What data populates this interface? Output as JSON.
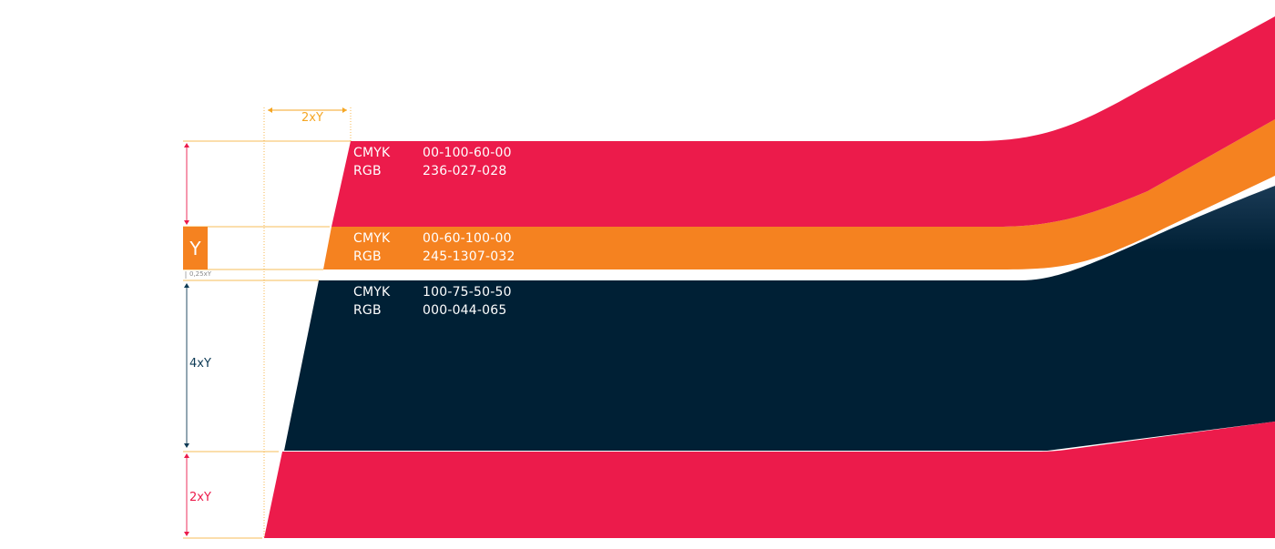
{
  "colors": {
    "red": "#ec1b4b",
    "orange": "#f58220",
    "navy": "#002035",
    "red_guide": "#ec1b4b",
    "orange_guide": "#f5a623",
    "navy_guide": "#0d3a55"
  },
  "swatches": [
    {
      "name": "red",
      "cmyk_label": "CMYK",
      "cmyk": "00-100-60-00",
      "rgb_label": "RGB",
      "rgb": "236-027-028"
    },
    {
      "name": "orange",
      "cmyk_label": "CMYK",
      "cmyk": "00-60-100-00",
      "rgb_label": "RGB",
      "rgb": "245-1307-032"
    },
    {
      "name": "navy",
      "cmyk_label": "CMYK",
      "cmyk": "100-75-50-50",
      "rgb_label": "RGB",
      "rgb": "000-044-065"
    }
  ],
  "dimensions": {
    "unit_box": "Y",
    "gap": "0,25xY",
    "top_width": "2xY",
    "navy_height": "4xY",
    "bottom_height": "2xY"
  }
}
